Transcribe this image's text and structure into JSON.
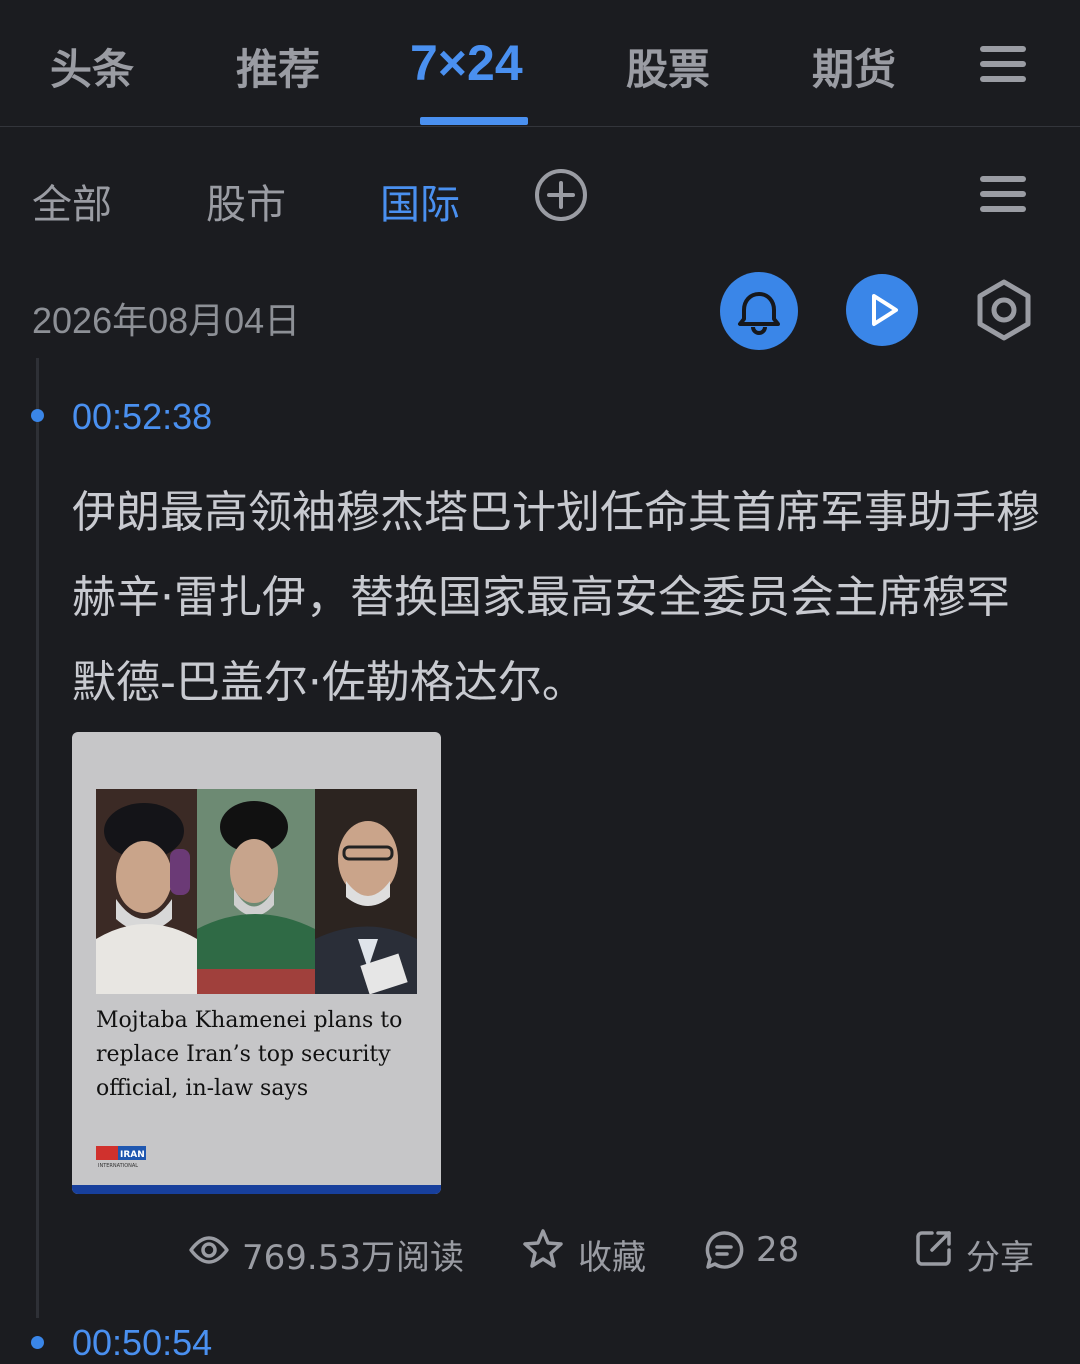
{
  "top_tabs": [
    "头条",
    "推荐",
    "7×24",
    "股票",
    "期货"
  ],
  "sub_tabs": [
    "全部",
    "股市",
    "国际"
  ],
  "date": "2026年08月04日",
  "items": [
    {
      "time": "00:52:38",
      "headline": "伊朗最高领袖穆杰塔巴计划任命其首席军事助手穆赫辛·雷扎伊，替换国家最高安全委员会主席穆罕默德-巴盖尔·佐勒格达尔。",
      "card": {
        "title": "Mojtaba Khamenei plans to replace Iran’s top security official, in-law says",
        "logo_text": "ایران IRAN",
        "logo_sub": "INTERNATIONAL"
      },
      "views": "769.53万",
      "views_label": "阅读",
      "favorite_label": "收藏",
      "comments": "28",
      "share_label": "分享"
    },
    {
      "time": "00:50:54"
    }
  ],
  "colors": {
    "accent": "#4a90f0",
    "background": "#1b1c20",
    "card_bar": "#173f9c"
  }
}
